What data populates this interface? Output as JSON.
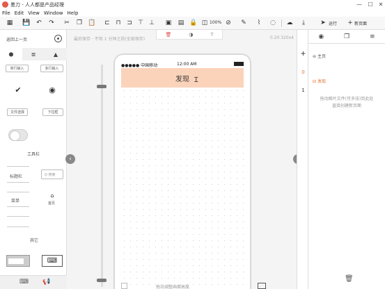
{
  "window": {
    "title": "墨刀 - 人人都是产品经理",
    "minimize": "—",
    "maximize": "☐",
    "close": "✕"
  },
  "menu": [
    "File",
    "Edit",
    "View",
    "Window",
    "Help"
  ],
  "toolbar": {
    "zoom": "100%",
    "run_label": "运行",
    "new_page_label": "新页面"
  },
  "status": {
    "saved_text": "最后保存 · 不到 1 分钟之前(全部保存)",
    "dims": "0.20 320x4"
  },
  "left_panel": {
    "back_label": "返回上一页",
    "components": {
      "single_input": "单行输入",
      "multi_input": "多行输入",
      "file_select": "文件选择",
      "dropdown": "下拉框",
      "checkmark": "✔",
      "radio": "◉",
      "toolbar_section": "工具栏",
      "titlebar": "标题栏",
      "search_placeholder": "Q 搜索",
      "menu_btn": "菜单",
      "home_btn": "首页",
      "other_section": "其它"
    }
  },
  "phone": {
    "carrier": "●●●●● 中国移动",
    "time": "12:00 AM",
    "nav_title": "发现"
  },
  "canvas_bottom": {
    "label": "拖动调整画面高度"
  },
  "side_column": {
    "add": "+",
    "zero": "0",
    "one": "1"
  },
  "right_panel": {
    "home_label": "主页",
    "page_label": "发现",
    "hint_line1": "拖动图片文件(可多张)到此处",
    "hint_line2": "直接创建新页面"
  }
}
